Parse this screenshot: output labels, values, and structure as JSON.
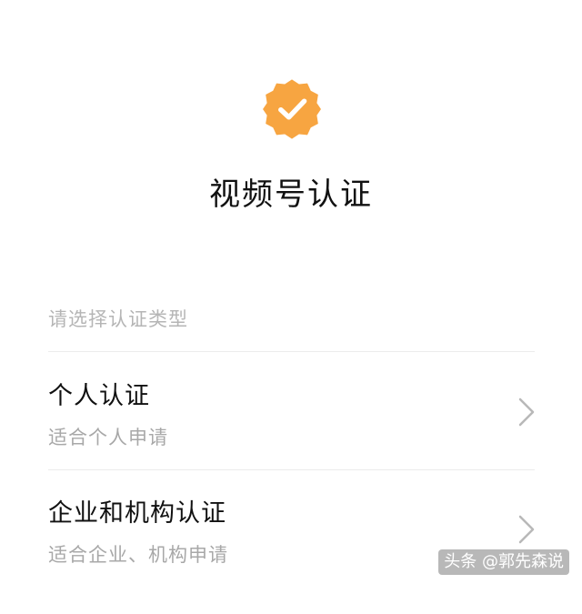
{
  "badge": {
    "icon": "verified-check-badge-icon",
    "color": "#F7A541"
  },
  "page": {
    "title": "视频号认证"
  },
  "section": {
    "label": "请选择认证类型"
  },
  "options": [
    {
      "title": "个人认证",
      "subtitle": "适合个人申请",
      "icon": "chevron-right-icon"
    },
    {
      "title": "企业和机构认证",
      "subtitle": "适合企业、机构申请",
      "icon": "chevron-right-icon"
    }
  ],
  "watermark": {
    "text": "头条 @郭先森说"
  }
}
